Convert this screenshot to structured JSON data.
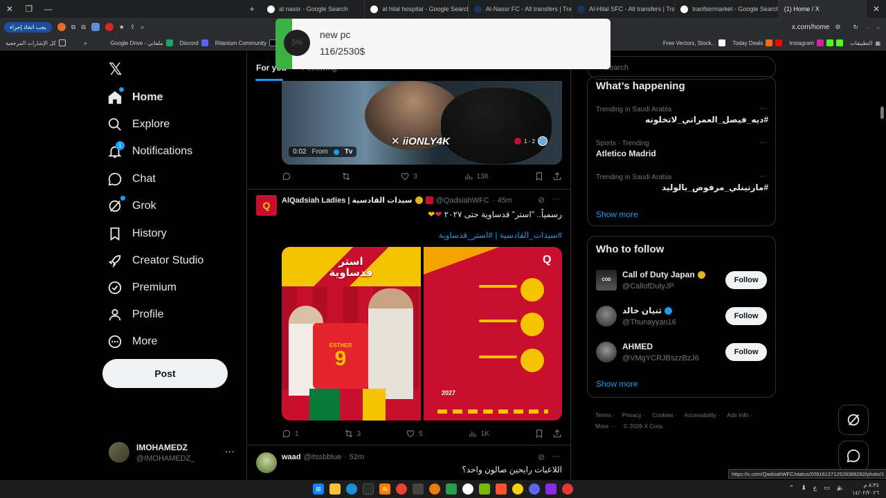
{
  "browser": {
    "tabs": [
      {
        "label": "al nassr - Google Search",
        "fav": "#4285f4"
      },
      {
        "label": "al hilal hospital - Google Search",
        "fav": "#4285f4"
      },
      {
        "label": "Al-Nassr FC - All transfers | Tra",
        "fav": "#1a3561"
      },
      {
        "label": "Al-Hilal SFC - All transfers | Tra",
        "fav": "#1a3561"
      },
      {
        "label": "tranfsermarket - Google Search",
        "fav": "#4285f4"
      },
      {
        "label": "(1) Home / X",
        "fav": "#000000"
      }
    ],
    "address": "x.com/home",
    "ext_label": "يجب اتخاذ إجراء",
    "bookmarks": [
      "كل الإشارات المرجعية",
      "Google Drive - ملفاتي",
      "Discord",
      "Ritanium Community",
      "Free Vectors, Stock...",
      "Today Deals",
      "Instagram",
      "التطبيقات"
    ],
    "status_url": "https://x.com/QadsiahWFC/status/2091613712528388282/photo/1"
  },
  "popup": {
    "title": "new pc",
    "progress": "116/2530$",
    "percent_label": "5%",
    "percent_value": 0.05
  },
  "nav": {
    "items": [
      {
        "label": "Home",
        "icon": "home-icon"
      },
      {
        "label": "Explore",
        "icon": "search-icon"
      },
      {
        "label": "Notifications",
        "icon": "bell-icon",
        "badge": "1"
      },
      {
        "label": "Chat",
        "icon": "chat-icon"
      },
      {
        "label": "Grok",
        "icon": "grok-icon"
      },
      {
        "label": "History",
        "icon": "bookmark-icon"
      },
      {
        "label": "Creator Studio",
        "icon": "rocket-icon"
      },
      {
        "label": "Premium",
        "icon": "verified-icon"
      },
      {
        "label": "Profile",
        "icon": "person-icon"
      },
      {
        "label": "More",
        "icon": "more-circle-icon"
      }
    ],
    "post_label": "Post",
    "account_name": "IMOHAMEDZ",
    "account_handle": "@IMOHAMEDZ_"
  },
  "feed": {
    "tabs": [
      "For you",
      "Following"
    ],
    "video_post": {
      "time": "0:02",
      "from_label": "From",
      "channel": "Tv",
      "watermark": "iiONLY4K",
      "score": "1 - 2",
      "stats": {
        "replies": "",
        "reposts": "",
        "likes": "3",
        "views": "138"
      }
    },
    "qadsiah_post": {
      "name": "AlQadsiah Ladies | سيدات القادسية",
      "handle": "@QadsiahWFC",
      "time": "45m",
      "text": "رسمياً.. \"استر\" قدساوية حتى ٢٠٢٧",
      "hashtags": "#سيدات_القادسية | #استر_قدساوية",
      "image_title": "استر قدساوية",
      "jersey_name": "ESTHER",
      "jersey_number": "9",
      "year": "2027",
      "stats": {
        "replies": "1",
        "reposts": "3",
        "likes": "5",
        "views": "1K"
      }
    },
    "waad_post": {
      "name": "waad",
      "handle": "@itssbblue",
      "time": "52m",
      "text": "اللاعبات رايحين صالون واحد؟"
    }
  },
  "right": {
    "search_placeholder": "Search",
    "happening_title": "What’s happening",
    "trends": [
      {
        "meta": "Trending in Saudi Arabia",
        "title": "#ديه_فيصل_العمراني_لاتخلونه"
      },
      {
        "meta": "Sports · Trending",
        "title": "Atletico Madrid"
      },
      {
        "meta": "Trending in Saudi Arabia",
        "title": "#مارتينلي_مرفوض_بالوليد"
      }
    ],
    "show_more": "Show more",
    "who_title": "Who to follow",
    "follow_label": "Follow",
    "who": [
      {
        "name": "Call of Duty Japan",
        "handle": "@CallofDutyJP"
      },
      {
        "name": "ثنيان خالد",
        "handle": "@Thunayyan16"
      },
      {
        "name": "AHMED",
        "handle": "@VMgYCRJBszzBzJ6"
      }
    ],
    "footer": [
      "Terms",
      "Privacy",
      "Cookies",
      "Accessibility",
      "Ads Info",
      "More ···",
      "© 2026 X Corp."
    ]
  },
  "taskbar": {
    "clock_time": "٨:٣٤ م",
    "clock_date": "١٤/٠٢/٢٠٢٦"
  },
  "colors": {
    "accent": "#1d9bf0",
    "popup_green": "#3cb043",
    "qadsiah_red": "#c8102e",
    "qadsiah_yellow": "#f5c400"
  }
}
